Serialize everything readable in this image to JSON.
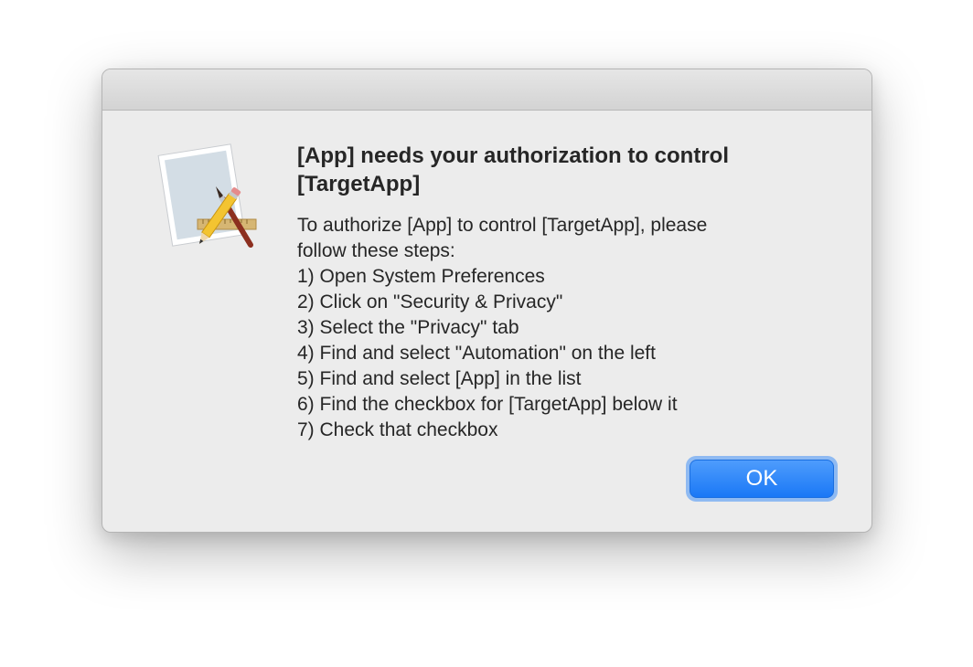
{
  "dialog": {
    "icon": "app-editor-pencil-brush-ruler-icon",
    "title": "[App] needs your authorization to control [TargetApp]",
    "message_lines": [
      "To authorize [App] to control [TargetApp], please",
      "follow these steps:",
      "1) Open System Preferences",
      "2) Click on \"Security & Privacy\"",
      "3) Select the \"Privacy\" tab",
      "4) Find and select \"Automation\" on the left",
      "5) Find and select [App] in the list",
      "6) Find the checkbox for [TargetApp] below it",
      "7) Check that checkbox"
    ],
    "ok_label": "OK"
  },
  "colors": {
    "accent": "#1a78f6",
    "dialog_background": "#ececec",
    "text": "#262626"
  }
}
